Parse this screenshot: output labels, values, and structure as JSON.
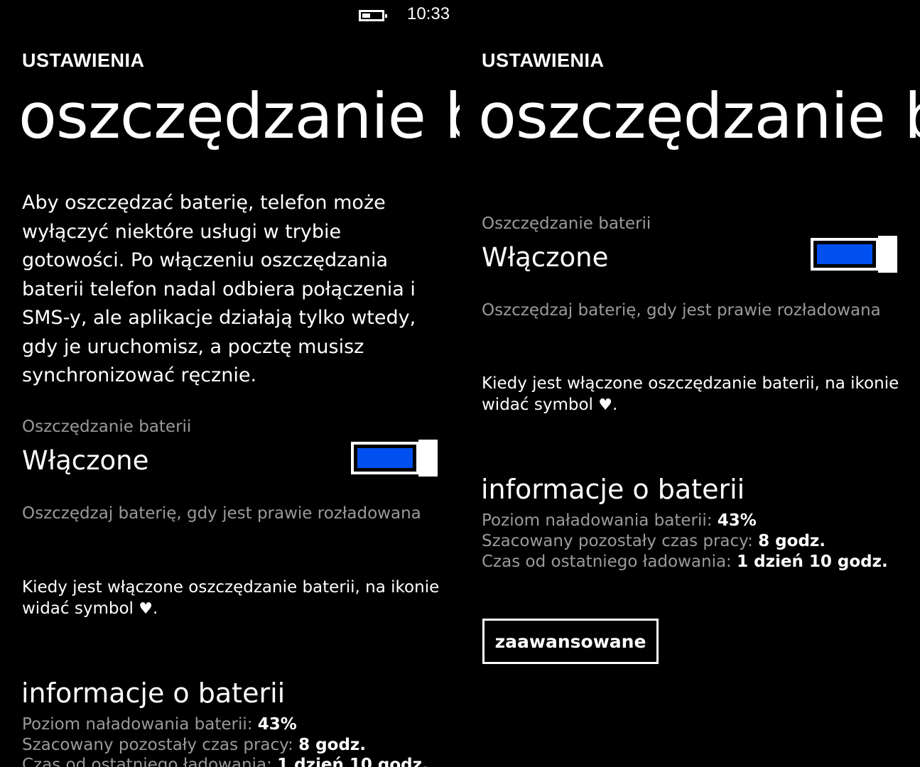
{
  "status_bar": {
    "time": "10:33",
    "battery_level": 0.43,
    "battery_icon": "battery-icon"
  },
  "header": {
    "app_title": "USTAWIENIA",
    "page_title": "oszczędzanie baterii"
  },
  "description": "Aby oszczędzać baterię, telefon może wyłączyć niektóre usługi w trybie gotowości. Po włączeniu oszczędzania baterii telefon nadal odbiera połączenia i SMS-y, ale aplikacje działają tylko wtedy, gdy je uruchomisz, a pocztę musisz synchronizować ręcznie.",
  "toggle": {
    "header": "Oszczędzanie baterii",
    "state_label": "Włączone",
    "is_on": true,
    "accent_color": "#0050EF"
  },
  "saver_option": "Oszczędzaj baterię, gdy jest prawie rozładowana",
  "note": {
    "text": "Kiedy jest włączone oszczędzanie baterii, na ikonie widać symbol",
    "symbol": "♥",
    "end": "."
  },
  "battery_info": {
    "title": "informacje o baterii",
    "charge_label": "Poziom naładowania baterii:",
    "charge_value": "43%",
    "remaining_label": "Szacowany pozostały czas pracy:",
    "remaining_value": "8 godz.",
    "since_charge_label": "Czas od ostatniego ładowania:",
    "since_charge_value": "1 dzień 10 godz."
  },
  "advanced_button": "zaawansowane"
}
